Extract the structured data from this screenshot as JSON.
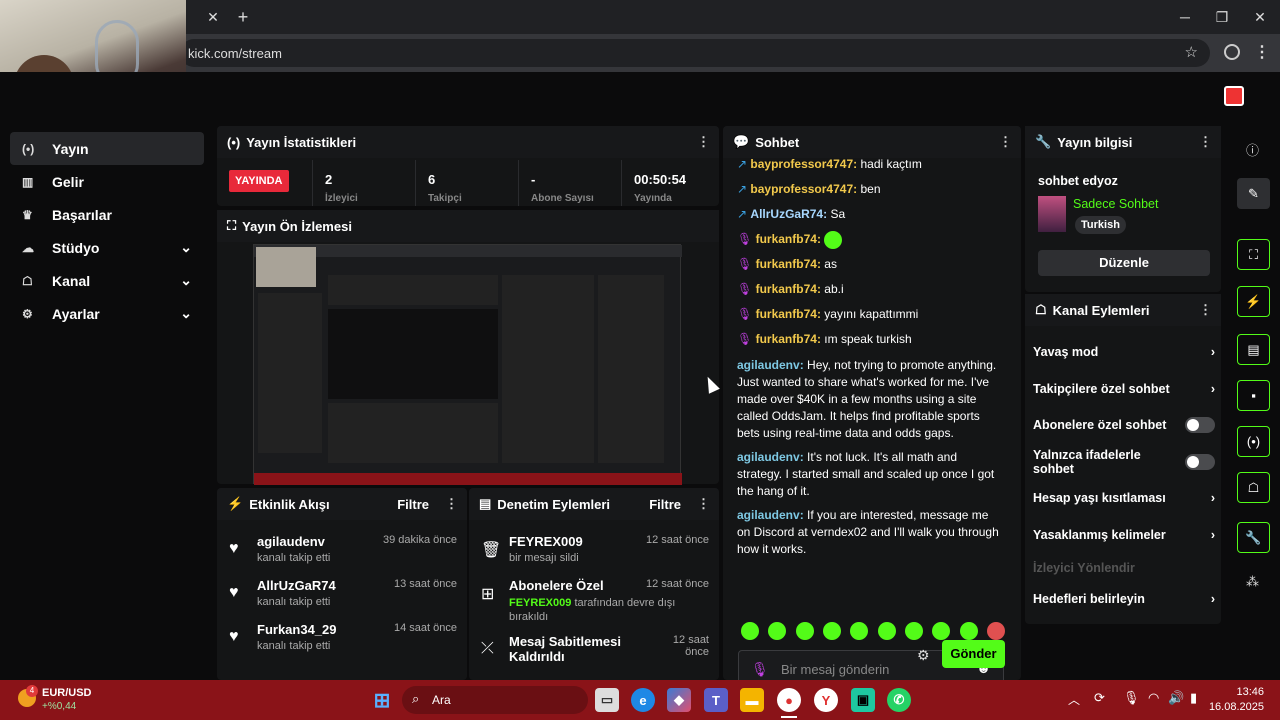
{
  "browser": {
    "url": "kick.com/stream",
    "close_tab": "✕",
    "new_tab": "+"
  },
  "sidebar": {
    "items": [
      {
        "label": "Yayın",
        "icon": "broadcast-icon"
      },
      {
        "label": "Gelir",
        "icon": "chart-icon"
      },
      {
        "label": "Başarılar",
        "icon": "trophy-icon"
      },
      {
        "label": "Stüdyo",
        "icon": "studio-icon"
      },
      {
        "label": "Kanal",
        "icon": "channel-icon"
      },
      {
        "label": "Ayarlar",
        "icon": "gear-icon"
      }
    ]
  },
  "stats": {
    "title": "Yayın İstatistikleri",
    "live_badge": "YAYINDA",
    "values": [
      "2",
      "6",
      "-",
      "00:50:54"
    ],
    "labels": [
      "İzleyici",
      "Takipçi",
      "Abone Sayısı",
      "Yayında"
    ]
  },
  "preview": {
    "title": "Yayın Ön İzlemesi"
  },
  "activity": {
    "title": "Etkinlik Akışı",
    "filter": "Filtre",
    "events": [
      {
        "name": "agilaudenv",
        "sub": "kanalı takip etti",
        "time": "39 dakika önce"
      },
      {
        "name": "AllrUzGaR74",
        "sub": "kanalı takip etti",
        "time": "13 saat önce"
      },
      {
        "name": "Furkan34_29",
        "sub": "kanalı takip etti",
        "time": "14 saat önce"
      }
    ]
  },
  "moderation": {
    "title": "Denetim Eylemleri",
    "filter": "Filtre",
    "events": [
      {
        "name": "FEYREX009",
        "sub": "bir mesajı sildi",
        "time": "12 saat önce"
      },
      {
        "name": "Abonelere Özel",
        "sub_user": "FEYREX009",
        "sub": "tarafından devre dışı bırakıldı",
        "time": "12 saat önce"
      },
      {
        "name": "Mesaj Sabitlemesi Kaldırıldı",
        "time": "12 saat önce"
      }
    ]
  },
  "chat": {
    "title": "Sohbet",
    "messages": [
      {
        "user": "bayprofessor4747",
        "text": "hadi kaçtım",
        "color": "#f2c94c"
      },
      {
        "user": "bayprofessor4747",
        "text": "ben",
        "color": "#f2c94c"
      },
      {
        "user": "AllrUzGaR74",
        "text": "Sa",
        "color": "#a8d8ff"
      },
      {
        "user": "furkanfb74",
        "text": "",
        "color": "#f2c94c"
      },
      {
        "user": "furkanfb74",
        "text": "as",
        "color": "#f2c94c"
      },
      {
        "user": "furkanfb74",
        "text": "ab.i",
        "color": "#f2c94c"
      },
      {
        "user": "furkanfb74",
        "text": "yayını kapattımmi",
        "color": "#f2c94c"
      },
      {
        "user": "furkanfb74",
        "text": "ım speak turkish",
        "color": "#f2c94c"
      },
      {
        "user": "agilaudenv",
        "text": "Hey, not trying to promote anything. Just wanted to share what's worked for me. I've made over $40K in a few months using a site called OddsJam. It helps find profitable sports bets using real-time data and odds gaps.",
        "color": "#7ec8e3"
      },
      {
        "user": "agilaudenv",
        "text": "It's not luck. It's all math and strategy. I started small and scaled up once I got the hang of it.",
        "color": "#7ec8e3"
      },
      {
        "user": "agilaudenv",
        "text": "If you are interested, message me on Discord at verndex02 and I'll walk you through how it works.",
        "color": "#7ec8e3"
      }
    ],
    "placeholder": "Bir mesaj gönderin",
    "send": "Gönder"
  },
  "info": {
    "title": "Yayın bilgisi",
    "stream_title": "sohbet edyoz",
    "category": "Sadece Sohbet",
    "language": "Turkish",
    "edit": "Düzenle"
  },
  "actions": {
    "title": "Kanal Eylemleri",
    "rows": [
      {
        "label": "Yavaş mod",
        "type": "arrow"
      },
      {
        "label": "Takipçilere özel sohbet",
        "type": "arrow"
      },
      {
        "label": "Abonelere özel sohbet",
        "type": "toggle"
      },
      {
        "label": "Yalnızca ifadelerle sohbet",
        "type": "toggle"
      },
      {
        "label": "Hesap yaşı kısıtlaması",
        "type": "arrow"
      },
      {
        "label": "Yasaklanmış kelimeler",
        "type": "arrow"
      },
      {
        "label": "İzleyici Yönlendir",
        "type": "disabled"
      },
      {
        "label": "Hedefleri belirleyin",
        "type": "arrow"
      }
    ]
  },
  "taskbar": {
    "ticker": "EUR/USD",
    "ticker_change": "+%0,44",
    "notif_count": "4",
    "search": "Ara",
    "time": "13:46",
    "date": "16.08.2025"
  },
  "colors": {
    "accent": "#53fc18",
    "live": "#e8293a",
    "taskbar": "#8a1318"
  }
}
